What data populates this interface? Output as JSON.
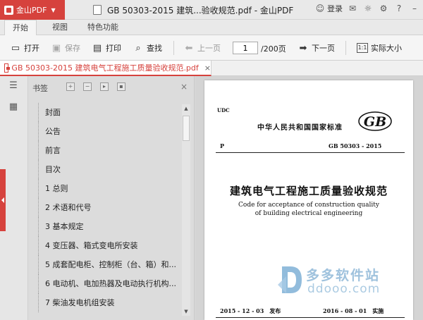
{
  "titlebar": {
    "brand": "金山PDF",
    "document_title": "GB 50303-2015 建筑...验收规范.pdf - 金山PDF",
    "login": "登录"
  },
  "tabs": [
    "开始",
    "视图",
    "特色功能"
  ],
  "toolbar": {
    "open": "打开",
    "save": "保存",
    "print": "打印",
    "find": "查找",
    "prev": "上一页",
    "page_current": "1",
    "page_total": "/200页",
    "next": "下一页",
    "actual_size": "实际大小"
  },
  "doc_tab": {
    "name": "GB 50303-2015 建筑电气工程施工质量验收规范.pdf",
    "close": "×"
  },
  "bookmark_panel": {
    "title": "书签",
    "close": "×",
    "items": [
      "封面",
      "公告",
      "前言",
      "目次",
      "1 总则",
      "2 术语和代号",
      "3 基本规定",
      "4 变压器、箱式变电所安装",
      "5 成套配电柜、控制柜（台、箱）和...",
      "6 电动机、电加热器及电动执行机构...",
      "7 柴油发电机组安装"
    ]
  },
  "page": {
    "udc": "UDC",
    "national_standard": "中华人民共和国国家标准",
    "gb_logo": "GB",
    "category": "P",
    "standard_number": "GB 50303 - 2015",
    "title_cn": "建筑电气工程施工质量验收规范",
    "title_en_1": "Code for acceptance of construction quality",
    "title_en_2": "of building electrical engineering",
    "issue": "2015 - 12 - 03　发布",
    "implement": "2016 - 08 - 01　实施"
  },
  "watermark": {
    "cn": "多多软件站",
    "url": "ddooo.com"
  },
  "icons": {
    "open": "folder-open-icon",
    "save": "save-icon",
    "print": "printer-icon",
    "find": "search-icon",
    "prev": "arrow-left-icon",
    "next": "arrow-right-icon",
    "actual_size": "actual-size-icon"
  },
  "colors": {
    "accent": "#d6423d",
    "watermark": "#8fb8d8"
  }
}
